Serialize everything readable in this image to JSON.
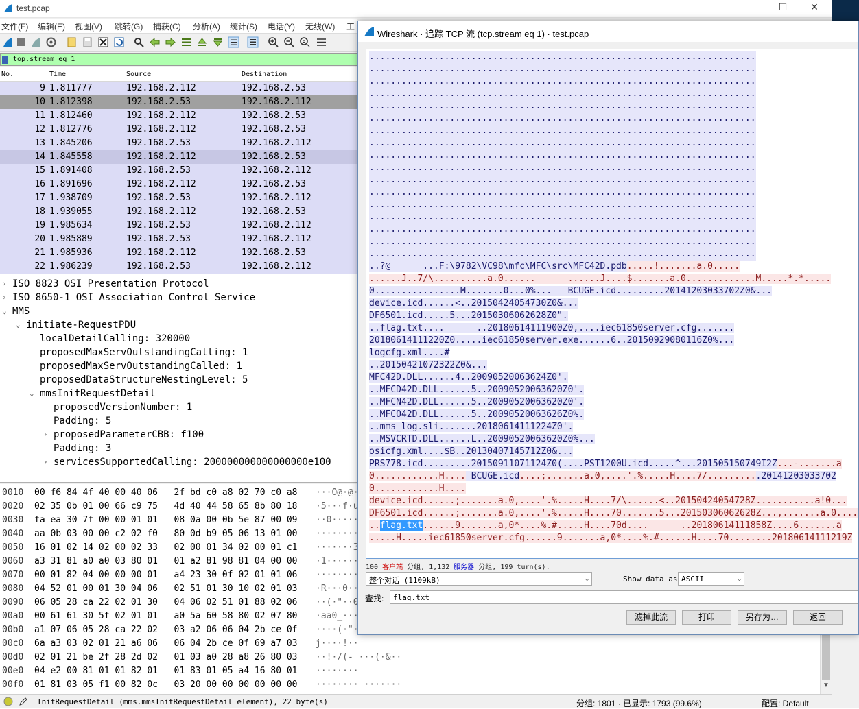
{
  "main_window": {
    "title": "test.pcap",
    "menu": [
      "文件(F)",
      "编辑(E)",
      "视图(V)",
      "跳转(G)",
      "捕获(C)",
      "分析(A)",
      "统计(S)",
      "电话(Y)",
      "无线(W)",
      "工"
    ],
    "filter": "top.stream eq 1",
    "columns": [
      "No.",
      "Time",
      "Source",
      "Destination"
    ],
    "packets": [
      {
        "no": "9",
        "time": "1.811777",
        "src": "192.168.2.112",
        "dst": "192.168.2.53"
      },
      {
        "no": "10",
        "time": "1.812398",
        "src": "192.168.2.53",
        "dst": "192.168.2.112"
      },
      {
        "no": "11",
        "time": "1.812460",
        "src": "192.168.2.112",
        "dst": "192.168.2.53"
      },
      {
        "no": "12",
        "time": "1.812776",
        "src": "192.168.2.112",
        "dst": "192.168.2.53"
      },
      {
        "no": "13",
        "time": "1.845206",
        "src": "192.168.2.53",
        "dst": "192.168.2.112"
      },
      {
        "no": "14",
        "time": "1.845558",
        "src": "192.168.2.112",
        "dst": "192.168.2.53"
      },
      {
        "no": "15",
        "time": "1.891408",
        "src": "192.168.2.53",
        "dst": "192.168.2.112"
      },
      {
        "no": "16",
        "time": "1.891696",
        "src": "192.168.2.112",
        "dst": "192.168.2.53"
      },
      {
        "no": "17",
        "time": "1.938709",
        "src": "192.168.2.53",
        "dst": "192.168.2.112"
      },
      {
        "no": "18",
        "time": "1.939055",
        "src": "192.168.2.112",
        "dst": "192.168.2.53"
      },
      {
        "no": "19",
        "time": "1.985634",
        "src": "192.168.2.53",
        "dst": "192.168.2.112"
      },
      {
        "no": "20",
        "time": "1.985889",
        "src": "192.168.2.53",
        "dst": "192.168.2.112"
      },
      {
        "no": "21",
        "time": "1.985936",
        "src": "192.168.2.112",
        "dst": "192.168.2.53"
      },
      {
        "no": "22",
        "time": "1.986239",
        "src": "192.168.2.53",
        "dst": "192.168.2.112"
      }
    ],
    "tree": [
      "ISO 8823 OSI Presentation Protocol",
      "ISO 8650-1 OSI Association Control Service",
      "MMS",
      "initiate-RequestPDU",
      "localDetailCalling: 320000",
      "proposedMaxServOutstandingCalling: 1",
      "proposedMaxServOutstandingCalled: 1",
      "proposedDataStructureNestingLevel: 5",
      "mmsInitRequestDetail",
      "proposedVersionNumber: 1",
      "Padding: 5",
      "proposedParameterCBB: f100",
      "Padding: 3",
      "servicesSupportedCalling: 200000000000000000e100"
    ],
    "hex": [
      {
        "off": "0010",
        "bytes": "00 f6 84 4f 40 00 40 06   2f bd c0 a8 02 70 c0 a8",
        "asc": "···O@·@·"
      },
      {
        "off": "0020",
        "bytes": "02 35 0b 01 00 66 c9 75   4d 40 44 58 65 8b 80 18",
        "asc": "·5···f·u"
      },
      {
        "off": "0030",
        "bytes": "fa ea 30 7f 00 00 01 01   08 0a 00 0b 5e 87 00 09",
        "asc": "··0·····"
      },
      {
        "off": "0040",
        "bytes": "aa 0b 03 00 00 c2 02 f0   80 0d b9 05 06 13 01 00",
        "asc": "········"
      },
      {
        "off": "0050",
        "bytes": "16 01 02 14 02 00 02 33   02 00 01 34 02 00 01 c1",
        "asc": "·······3"
      },
      {
        "off": "0060",
        "bytes": "a3 31 81 a0 a0 03 80 01   01 a2 81 98 81 04 00 00",
        "asc": "·1······"
      },
      {
        "off": "0070",
        "bytes": "00 01 82 04 00 00 00 01   a4 23 30 0f 02 01 01 06",
        "asc": "········"
      },
      {
        "off": "0080",
        "bytes": "04 52 01 00 01 30 04 06   02 51 01 30 10 02 01 03",
        "asc": "·R···0··"
      },
      {
        "off": "0090",
        "bytes": "06 05 28 ca 22 02 01 30   04 06 02 51 01 88 02 06",
        "asc": "··(·\"··0"
      },
      {
        "off": "00a0",
        "bytes": "00 61 61 30 5f 02 01 01   a0 5a 60 58 80 02 07 80",
        "asc": "·aa0_···"
      },
      {
        "off": "00b0",
        "bytes": "a1 07 06 05 28 ca 22 02   03 a2 06 06 04 2b ce 0f",
        "asc": "····(·\"·"
      },
      {
        "off": "00c0",
        "bytes": "6a a3 03 02 01 21 a6 06   06 04 2b ce 0f 69 a7 03",
        "asc": "j····!··"
      },
      {
        "off": "00d0",
        "bytes": "02 01 21 be 2f 28 2d 02   01 03 a0 28 a8 26 80 03",
        "asc": "··!·/(- ···(·&··"
      },
      {
        "off": "00e0",
        "bytes": "04 e2 00 81 01 01 82 01   01 83 01 05 a4 16 80 01",
        "asc": "········"
      },
      {
        "off": "00f0",
        "bytes": "01 81 03 05 f1 00 82 0c   03 20 00 00 00 00 00 00",
        "asc": "········ ·······"
      },
      {
        "off": "0100",
        "bytes": "00 00 e1 00",
        "asc": "····"
      }
    ],
    "status": {
      "field": "InitRequestDetail (mms.mmsInitRequestDetail_element), 22 byte(s)",
      "packets": "分组: 1801 · 已显示: 1793 (99.6%)",
      "profile": "配置: Default"
    }
  },
  "dialog": {
    "title": "Wireshark · 追踪 TCP 流 (tcp.stream eq 1) · test.pcap",
    "lines": [
      {
        "t": "dots",
        "text": "........................................................................"
      },
      {
        "t": "dots",
        "text": "........................................................................"
      },
      {
        "t": "dots",
        "text": "........................................................................"
      },
      {
        "t": "dots",
        "text": "........................................................................"
      },
      {
        "t": "dots",
        "text": "........................................................................"
      },
      {
        "t": "dots",
        "text": "........................................................................"
      },
      {
        "t": "dots",
        "text": "........................................................................"
      },
      {
        "t": "dots",
        "text": "........................................................................"
      },
      {
        "t": "dots",
        "text": "........................................................................"
      },
      {
        "t": "dots",
        "text": "........................................................................"
      },
      {
        "t": "dots",
        "text": "........................................................................"
      },
      {
        "t": "dots",
        "text": "........................................................................"
      },
      {
        "t": "dots",
        "text": "........................................................................"
      },
      {
        "t": "dots",
        "text": "........................................................................"
      },
      {
        "t": "dots",
        "text": "........................................................................"
      },
      {
        "t": "dots",
        "text": "........................................................................"
      },
      {
        "t": "dots",
        "text": "........................................................................"
      }
    ],
    "content": [
      {
        "seg": [
          {
            "c": "cl",
            "x": "..?@      ...F:\\9782\\VC98\\mfc\\MFC\\src\\MFC42D.pdb"
          },
          {
            "c": "sv",
            "x": ".....!.......a.0....."
          }
        ]
      },
      {
        "seg": [
          {
            "c": "sv",
            "x": "......J..7/\\..........a.0......      ......J....$.......a.0.............M.....*.*....."
          }
        ]
      },
      {
        "seg": [
          {
            "c": "cl",
            "x": "0................M.......0...0%...   BCUGE.icd.........20141203033702Z0&..."
          }
        ]
      },
      {
        "seg": [
          {
            "c": "cl",
            "x": "device.icd......<..20150424054730Z0&..."
          }
        ]
      },
      {
        "seg": [
          {
            "c": "cl",
            "x": "DF6501.icd.....5...20150306062628Z0\"."
          }
        ]
      },
      {
        "seg": [
          {
            "c": "cl",
            "x": "..flag.txt....      ..20180614111900Z0,....iec61850server.cfg......."
          }
        ]
      },
      {
        "seg": [
          {
            "c": "cl",
            "x": "20180614111220Z0.....iec61850server.exe......6..20150929080116Z0%..."
          }
        ]
      },
      {
        "seg": [
          {
            "c": "cl",
            "x": "logcfg.xml....#"
          }
        ]
      },
      {
        "seg": [
          {
            "c": "cl",
            "x": "..20150421072322Z0&..."
          }
        ]
      },
      {
        "seg": [
          {
            "c": "cl",
            "x": "MFC42D.DLL......4..20090520063624Z0'."
          }
        ]
      },
      {
        "seg": [
          {
            "c": "cl",
            "x": "..MFCD42D.DLL......5..20090520063620Z0'."
          }
        ]
      },
      {
        "seg": [
          {
            "c": "cl",
            "x": "..MFCN42D.DLL......5..20090520063620Z0'."
          }
        ]
      },
      {
        "seg": [
          {
            "c": "cl",
            "x": "..MFCO42D.DLL......5..20090520063626Z0%."
          }
        ]
      },
      {
        "seg": [
          {
            "c": "cl",
            "x": "..mms_log.sli.......20180614111224Z0'."
          }
        ]
      },
      {
        "seg": [
          {
            "c": "cl",
            "x": "..MSVCRTD.DLL......L..20090520063620Z0%..."
          }
        ]
      },
      {
        "seg": [
          {
            "c": "cl",
            "x": "osicfg.xml....$B..20130407145712Z0&..."
          }
        ]
      },
      {
        "seg": [
          {
            "c": "cl",
            "x": "PRS778.icd.........20150911071124Z0(....PST1200U.icd.....^...201505150749I2Z"
          },
          {
            "c": "sv",
            "x": "...-.......a"
          }
        ]
      },
      {
        "seg": [
          {
            "c": "sv",
            "x": "0............H...."
          },
          {
            "c": "cl",
            "x": " BCUGE.icd"
          },
          {
            "c": "sv",
            "x": "....;.......a.0,....'.%.....H....7/........."
          },
          {
            "c": "cl",
            "x": ".20141203033702"
          }
        ]
      },
      {
        "seg": [
          {
            "c": "sv",
            "x": "0............H...."
          }
        ]
      },
      {
        "seg": [
          {
            "c": "sv",
            "x": "device.icd......;.......a.0,....'.%.....H....7/\\......<..20150424054728Z...........a!0..."
          }
        ]
      },
      {
        "seg": [
          {
            "c": "sv",
            "x": "DF6501.icd......;.......a.0,....'.%.....H....70.......5...20150306062628Z...,.......a.0...."
          }
        ]
      },
      {
        "seg": [
          {
            "c": "sv",
            "x": ".."
          },
          {
            "c": "findsel",
            "x": "flag.txt"
          },
          {
            "c": "sv",
            "x": "......9.......a,0*....%.#.....H....70d....      ..20180614111858Z....6.......a"
          }
        ]
      },
      {
        "seg": [
          {
            "c": "sv",
            "x": ".....H.....iec61850server.cfg......9.......a,0*....%.#......H....70........20180614111219Z"
          }
        ]
      }
    ],
    "stats": {
      "prefix": "100 ",
      "client": "客户端",
      "mid": " 分组, 1,132 ",
      "server": "服务器",
      "suffix": " 分组, 199 turn(s)."
    },
    "conversation": "整个对话 (1109kB)",
    "show_as_label": "Show data as",
    "show_as": "ASCII",
    "find_label": "查找:",
    "find_value": "flag.txt",
    "buttons": [
      "滤掉此流",
      "打印",
      "另存为…",
      "返回"
    ]
  }
}
